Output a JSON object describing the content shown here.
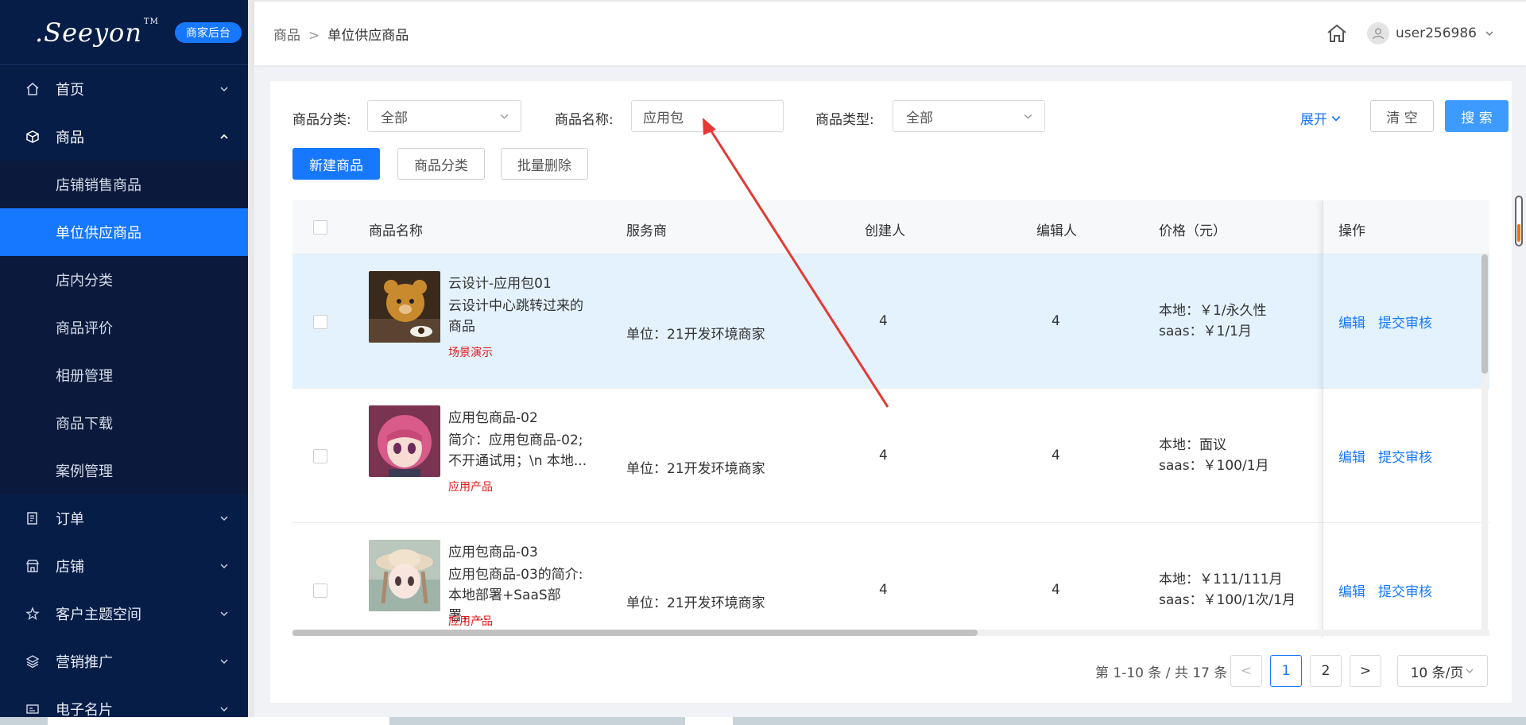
{
  "app": {
    "logo_text": ".Seeyon",
    "logo_tm": "TM",
    "badge": "商家后台"
  },
  "sidebar": {
    "items": [
      {
        "label": "首页",
        "icon": "home-icon"
      },
      {
        "label": "商品",
        "icon": "cube-icon",
        "expanded": true
      },
      {
        "label": "订单",
        "icon": "document-icon"
      },
      {
        "label": "店铺",
        "icon": "store-icon"
      },
      {
        "label": "客户主题空间",
        "icon": "star-icon"
      },
      {
        "label": "营销推广",
        "icon": "layers-icon"
      },
      {
        "label": "电子名片",
        "icon": "card-icon"
      }
    ],
    "sub_items": [
      {
        "label": "店铺销售商品"
      },
      {
        "label": "单位供应商品",
        "selected": true
      },
      {
        "label": "店内分类"
      },
      {
        "label": "商品评价"
      },
      {
        "label": "相册管理"
      },
      {
        "label": "商品下载"
      },
      {
        "label": "案例管理"
      }
    ]
  },
  "header": {
    "breadcrumb": [
      "商品",
      "单位供应商品"
    ],
    "breadcrumb_sep": ">",
    "username": "user256986"
  },
  "filters": {
    "category_label": "商品分类:",
    "category_value": "全部",
    "name_label": "商品名称:",
    "name_value": "应用包",
    "type_label": "商品类型:",
    "type_value": "全部",
    "expand_label": "展开",
    "clear_label": "清 空",
    "search_label": "搜 索"
  },
  "actions": {
    "new_label": "新建商品",
    "category_label": "商品分类",
    "batch_delete_label": "批量删除"
  },
  "table": {
    "columns": [
      "商品名称",
      "服务商",
      "创建人",
      "编辑人",
      "价格（元）",
      "操作"
    ],
    "rows": [
      {
        "name": "云设计-应用包01",
        "desc_lines": [
          "云设计中心跳转过来的",
          "商品"
        ],
        "tag": "场景演示",
        "vendor": "单位：21开发环境商家",
        "creator": "4",
        "editor": "4",
        "price_lines": [
          "本地：￥1/永久性",
          "saas：￥1/1月"
        ],
        "op_edit": "编辑",
        "op_submit": "提交审核",
        "highlighted": true
      },
      {
        "name": "应用包商品-02",
        "desc_lines": [
          "简介：应用包商品-02;",
          "不开通试用；\\n 本地..."
        ],
        "tag": "应用产品",
        "vendor": "单位：21开发环境商家",
        "creator": "4",
        "editor": "4",
        "price_lines": [
          "本地：面议",
          "saas：￥100/1月"
        ],
        "op_edit": "编辑",
        "op_submit": "提交审核",
        "highlighted": false
      },
      {
        "name": "应用包商品-03",
        "desc_lines": [
          "应用包商品-03的简介:",
          "本地部署+SaaS部署，..."
        ],
        "tag": "应用产品",
        "vendor": "单位：21开发环境商家",
        "creator": "4",
        "editor": "4",
        "price_lines": [
          "本地：￥111/111月",
          "saas：￥100/1次/1月"
        ],
        "op_edit": "编辑",
        "op_submit": "提交审核",
        "highlighted": false
      }
    ]
  },
  "pagination": {
    "summary": "第 1-10 条 / 共 17 条",
    "prev": "<",
    "next": ">",
    "pages": [
      "1",
      "2"
    ],
    "current": "1",
    "page_size": "10 条/页"
  },
  "colors": {
    "sidebar_bg": "#061d48",
    "primary": "#1677ff",
    "tag_red": "#e5191b",
    "row_highlight": "#e3f2fd",
    "annotation_arrow": "#e53935"
  }
}
